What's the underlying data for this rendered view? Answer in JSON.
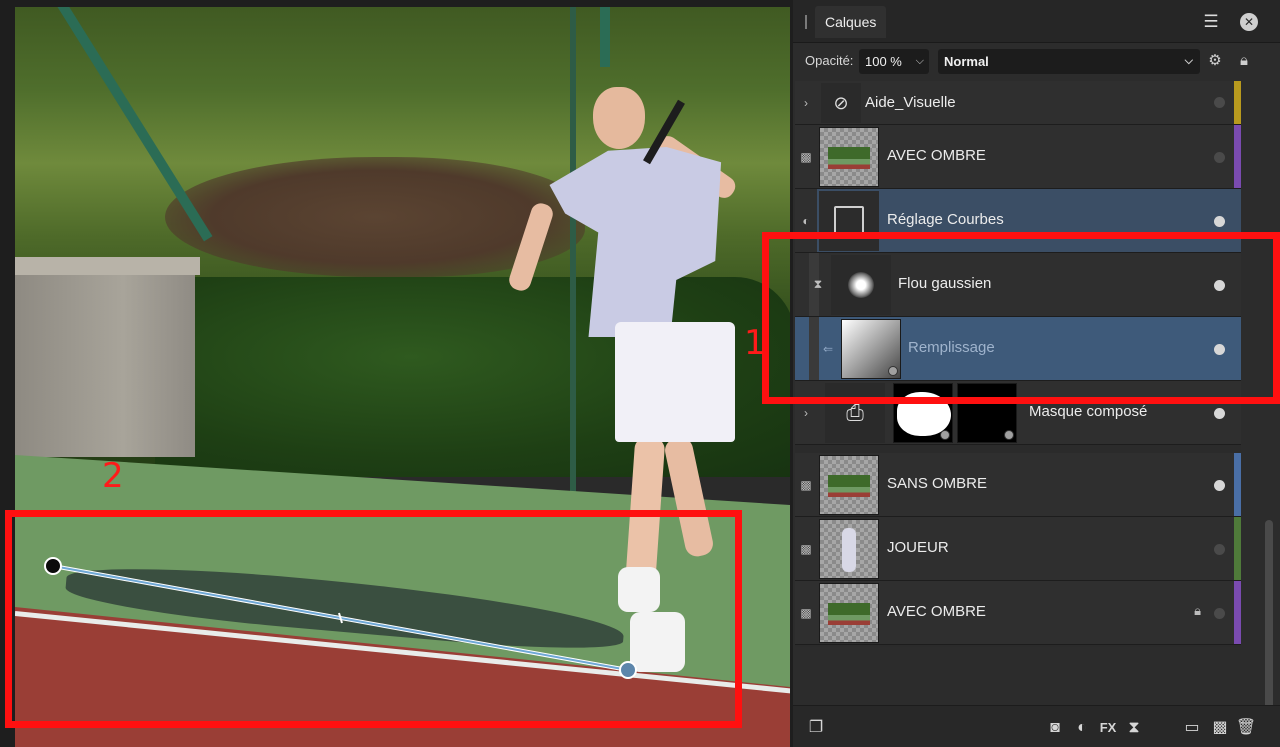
{
  "panel": {
    "tab": "Calques",
    "opacity_label": "Opacité:",
    "opacity_value": "100 %",
    "blend_mode": "Normal"
  },
  "layers": [
    {
      "name": "Aide_Visuelle",
      "icon": "folder-icon",
      "tag": "#b89a1e"
    },
    {
      "name": "AVEC OMBRE",
      "icon": "photo-thumb",
      "tag": "#7a4bb0"
    },
    {
      "name": "Réglage Courbes",
      "icon": "curves-icon",
      "tag": ""
    },
    {
      "name": "Flou gaussien",
      "icon": "blur-icon",
      "tag": ""
    },
    {
      "name": "Remplissage",
      "icon": "gradient-thumb",
      "tag": ""
    },
    {
      "name": "Masque composé",
      "icon": "compound-mask-icon",
      "tag": ""
    },
    {
      "name": "SANS OMBRE",
      "icon": "photo-thumb",
      "tag": "#4a6fa6"
    },
    {
      "name": "JOUEUR",
      "icon": "player-thumb",
      "tag": "#4f7a3a"
    },
    {
      "name": "AVEC OMBRE",
      "icon": "photo-thumb",
      "tag": "#7a4bb0"
    }
  ],
  "annotations": {
    "one": "1",
    "two": "2"
  },
  "colors": {
    "annotation": "#ff1010",
    "selection": "#3e5a7a",
    "gradient_handle": "#6fa8d6"
  }
}
